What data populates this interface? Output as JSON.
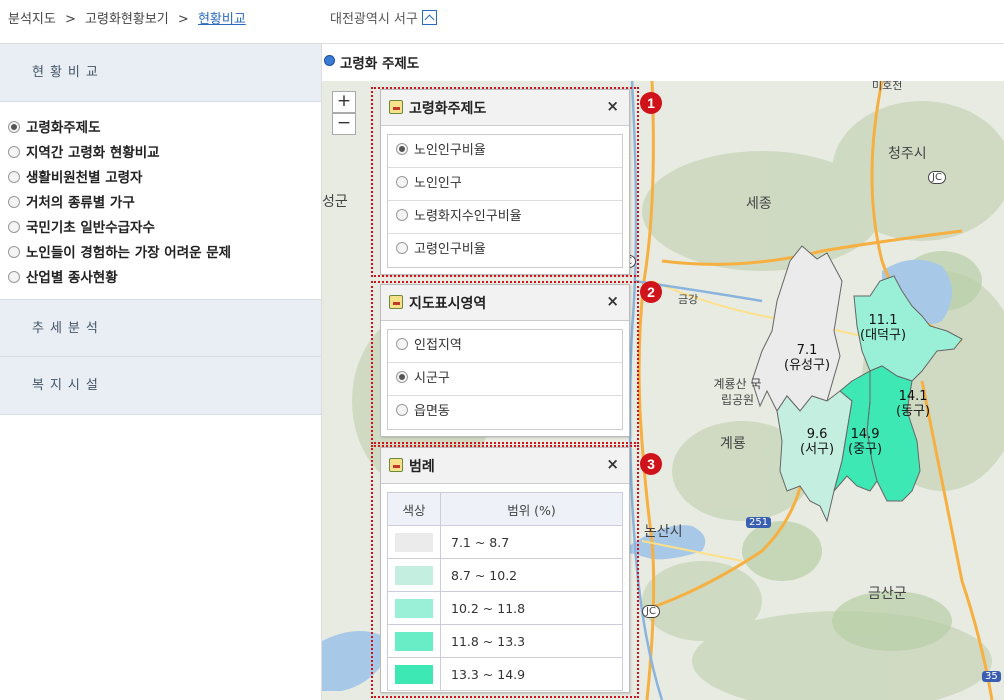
{
  "breadcrumb": {
    "item1": "분석지도",
    "sep": ">",
    "item2": "고령화현황보기",
    "item3": "현황비교"
  },
  "region": {
    "label": "대전광역시 서구"
  },
  "sidebar": {
    "sections": [
      "현황비교",
      "추세분석",
      "복지시설"
    ],
    "items": [
      {
        "label": "고령화주제도",
        "selected": true
      },
      {
        "label": "지역간 고령화 현황비교",
        "selected": false
      },
      {
        "label": "생활비원천별 고령자",
        "selected": false
      },
      {
        "label": "거처의 종류별 가구",
        "selected": false
      },
      {
        "label": "국민기초 일반수급자수",
        "selected": false
      },
      {
        "label": "노인들이 경험하는 가장 어려운 문제",
        "selected": false
      },
      {
        "label": "산업별 종사현황",
        "selected": false
      }
    ]
  },
  "map_title": "고령화 주제도",
  "zoom": {
    "in": "+",
    "out": "−"
  },
  "panel1": {
    "title": "고령화주제도",
    "close": "×",
    "badge": "1",
    "options": [
      {
        "label": "노인인구비율",
        "selected": true
      },
      {
        "label": "노인인구",
        "selected": false
      },
      {
        "label": "노령화지수인구비율",
        "selected": false
      },
      {
        "label": "고령인구비율",
        "selected": false
      }
    ]
  },
  "panel2": {
    "title": "지도표시영역",
    "close": "×",
    "badge": "2",
    "options": [
      {
        "label": "인접지역",
        "selected": false
      },
      {
        "label": "시군구",
        "selected": true
      },
      {
        "label": "읍면동",
        "selected": false
      }
    ]
  },
  "panel3": {
    "title": "범례",
    "close": "×",
    "badge": "3",
    "col_color": "색상",
    "col_range": "범위 (%)",
    "rows": [
      {
        "range": "7.1 ~ 8.7",
        "color": "#ebebeb"
      },
      {
        "range": "8.7 ~ 10.2",
        "color": "#c4eee0"
      },
      {
        "range": "10.2 ~ 11.8",
        "color": "#9af0d6"
      },
      {
        "range": "11.8 ~ 13.3",
        "color": "#68edc7"
      },
      {
        "range": "13.3 ~ 14.9",
        "color": "#3ee8b4"
      }
    ]
  },
  "districts": [
    {
      "value": "7.1",
      "name": "(유성구)",
      "color": "#ebebeb"
    },
    {
      "value": "9.6",
      "name": "(서구)",
      "color": "#c4eee0"
    },
    {
      "value": "11.1",
      "name": "(대덕구)",
      "color": "#9af0d6"
    },
    {
      "value": "14.1",
      "name": "(동구)",
      "color": "#3ee8b4"
    },
    {
      "value": "14.9",
      "name": "(중구)",
      "color": "#3ee8b4"
    }
  ],
  "map_labels": [
    "청주시",
    "세종",
    "성군",
    "금강",
    "계룡산 국립공원",
    "계룡",
    "논산시",
    "금산군",
    "JC",
    "JC",
    "JC",
    "251",
    "35",
    "미호천"
  ]
}
